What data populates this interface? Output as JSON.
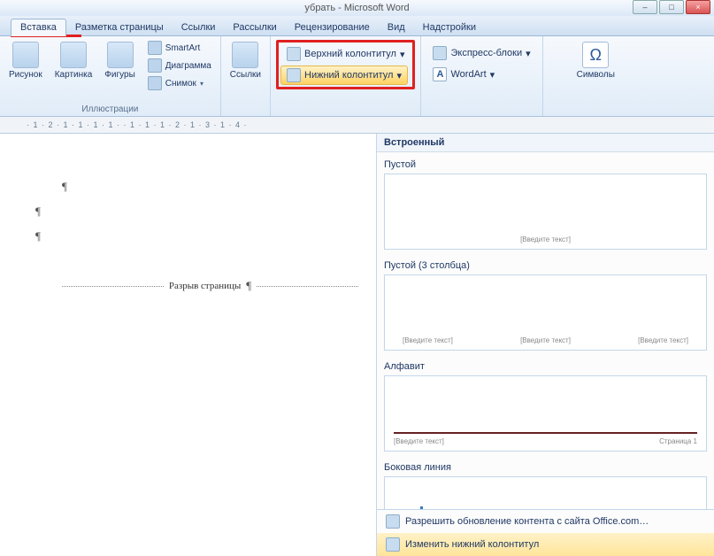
{
  "titlebar": {
    "title": "убрать - Microsoft Word"
  },
  "tabs": [
    "Вставка",
    "Разметка страницы",
    "Ссылки",
    "Рассылки",
    "Рецензирование",
    "Вид",
    "Надстройки"
  ],
  "ribbon": {
    "illustrations": {
      "picture": "Рисунок",
      "clipart": "Картинка",
      "shapes": "Фигуры",
      "smartart": "SmartArt",
      "chart": "Диаграмма",
      "screenshot": "Снимок",
      "group_label": "Иллюстрации"
    },
    "links": {
      "links": "Ссылки"
    },
    "headerfooter": {
      "header": "Верхний колонтитул",
      "footer": "Нижний колонтитул"
    },
    "text": {
      "quickparts": "Экспресс-блоки",
      "wordart": "WordArt"
    },
    "symbols": {
      "symbol": "Символы"
    }
  },
  "ruler": "· 1 · 2 · 1 · 1 · 1 · 1 ·  · 1 · 1 · 1 · 2 · 1 · 3 · 1 · 4 ·",
  "document": {
    "pagebreak": "Разрыв страницы"
  },
  "gallery": {
    "header": "Встроенный",
    "items": [
      {
        "title": "Пустой",
        "type": "single",
        "ph": "[Введите текст]"
      },
      {
        "title": "Пустой (3 столбца)",
        "type": "three",
        "ph": "[Введите текст]"
      },
      {
        "title": "Алфавит",
        "type": "alpha",
        "ph_left": "[Введите текст]",
        "ph_right": "Страница 1"
      },
      {
        "title": "Боковая линия",
        "type": "side"
      }
    ],
    "footer": {
      "update": "Разрешить обновление контента с сайта Office.com…",
      "edit": "Изменить нижний колонтитул"
    }
  }
}
